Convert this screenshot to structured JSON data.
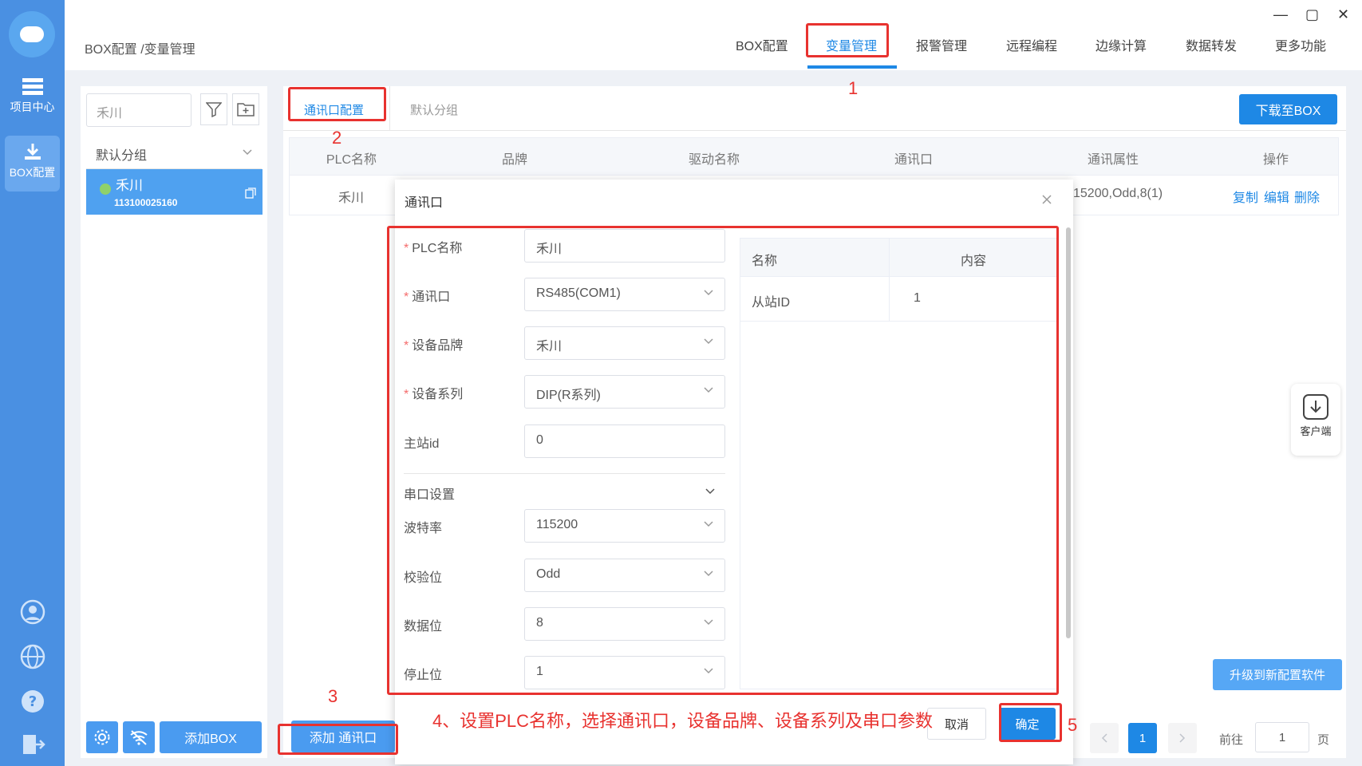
{
  "app": {
    "breadcrumb": "BOX配置 /变量管理",
    "window_controls": [
      "—",
      "▢",
      "✕"
    ]
  },
  "rail": {
    "items": [
      {
        "label": "项目中心",
        "icon": "grid-list-icon"
      },
      {
        "label": "BOX配置",
        "icon": "download-icon"
      }
    ],
    "bottom_icons": [
      "user-icon",
      "globe-icon",
      "help-icon",
      "logout-icon"
    ]
  },
  "topnav": {
    "items": [
      "BOX配置",
      "变量管理",
      "报警管理",
      "远程编程",
      "边缘计算",
      "数据转发",
      "更多功能"
    ],
    "active": "变量管理"
  },
  "left_panel": {
    "search_value": "禾川",
    "group_label": "默认分组",
    "device": {
      "name": "禾川",
      "serial": "113100025160",
      "status_color": "#8fd16a"
    },
    "buttons": {
      "add_box": "添加BOX"
    }
  },
  "main": {
    "tabs": [
      "通讯口配置",
      "默认分组"
    ],
    "active_tab": "通讯口配置",
    "download_btn": "下载至BOX",
    "table": {
      "headers": [
        "PLC名称",
        "品牌",
        "驱动名称",
        "通讯口",
        "通讯属性",
        "操作"
      ],
      "rows": [
        {
          "plc_name": "禾川",
          "comm_props": "15200,Odd,8(1)",
          "actions": [
            "复制",
            "编辑",
            "删除"
          ]
        }
      ]
    },
    "add_port_btn": "添加 通讯口",
    "upgrade_btn": "升级到新配置软件",
    "client_label": "客户端",
    "pager": {
      "current": "1",
      "goto_label": "前往",
      "goto_value": "1",
      "page_suffix": "页"
    }
  },
  "modal": {
    "title": "通讯口",
    "fields": [
      {
        "label": "PLC名称",
        "required": true,
        "value": "禾川",
        "type": "input"
      },
      {
        "label": "通讯口",
        "required": true,
        "value": "RS485(COM1)",
        "type": "select"
      },
      {
        "label": "设备品牌",
        "required": true,
        "value": "禾川",
        "type": "select"
      },
      {
        "label": "设备系列",
        "required": true,
        "value": "DIP(R系列)",
        "type": "select"
      },
      {
        "label": "主站id",
        "required": false,
        "value": "0",
        "type": "input"
      }
    ],
    "serial_section": "串口设置",
    "serial_fields": [
      {
        "label": "波特率",
        "value": "115200"
      },
      {
        "label": "校验位",
        "value": "Odd"
      },
      {
        "label": "数据位",
        "value": "8"
      },
      {
        "label": "停止位",
        "value": "1"
      }
    ],
    "subtable": {
      "headers": [
        "名称",
        "内容"
      ],
      "rows": [
        {
          "name": "从站ID",
          "content": "1"
        }
      ]
    },
    "cancel_btn": "取消",
    "ok_btn": "确定"
  },
  "annotations": {
    "n1": "1",
    "n2": "2",
    "n3": "3",
    "n5": "5",
    "step4": "4、设置PLC名称，选择通讯口，设备品牌、设备系列及串口参数",
    "color": "#e8322f"
  }
}
